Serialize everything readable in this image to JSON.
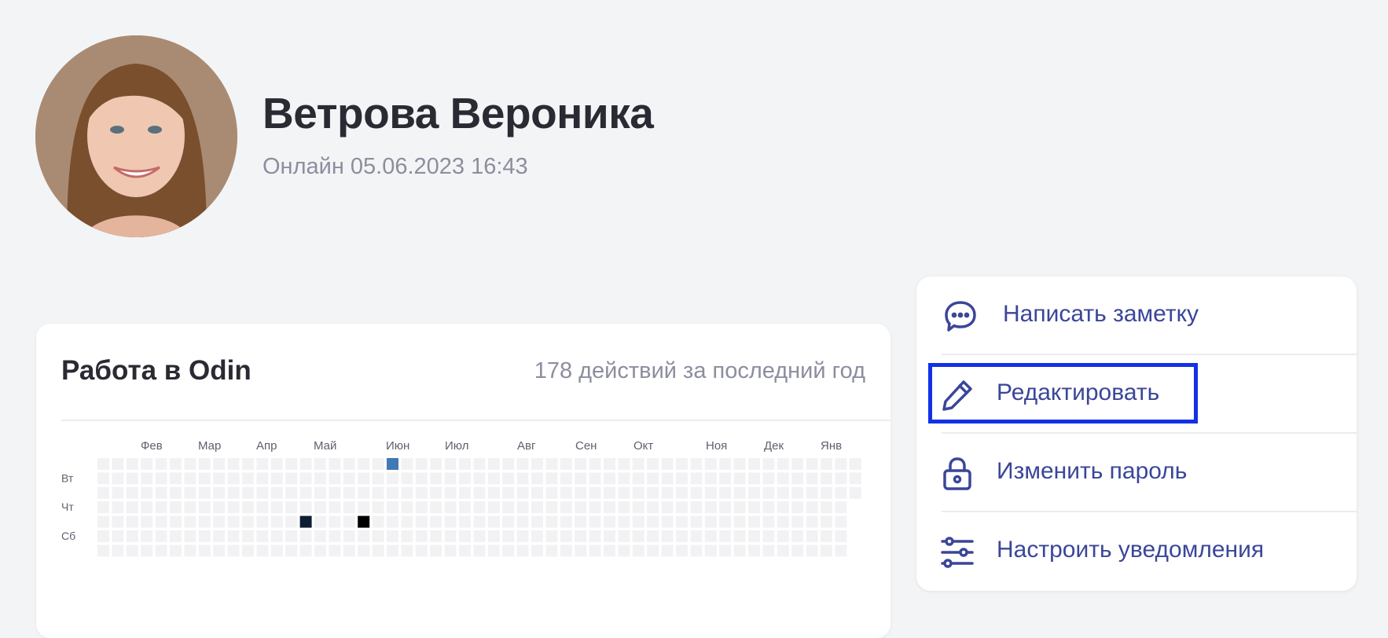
{
  "profile": {
    "name": "Ветрова Вероника",
    "status": "Онлайн 05.06.2023 16:43",
    "avatar_icon": "user-photo"
  },
  "activity": {
    "title": "Работа в Odin",
    "summary": "178 действий за последний год",
    "months": [
      "Фев",
      "Мар",
      "Апр",
      "Май",
      "Июн",
      "Июл",
      "Авг",
      "Сен",
      "Окт",
      "Ноя",
      "Дек",
      "Янв"
    ],
    "weekdays": [
      "Вт",
      "Чт",
      "Сб"
    ],
    "weeks": 53,
    "days_per_week": 7,
    "empty_color": "#f2f2f4",
    "highlighted_cells": [
      {
        "week": 20,
        "day": 0,
        "color": "#3f7ab5"
      },
      {
        "week": 14,
        "day": 4,
        "color": "#0e1f33"
      },
      {
        "week": 18,
        "day": 4,
        "color": "#000000"
      }
    ]
  },
  "actions": [
    {
      "label": "Написать заметку",
      "icon": "chat-bubble-icon"
    },
    {
      "label": "Редактировать",
      "icon": "pencil-icon"
    },
    {
      "label": "Изменить пароль",
      "icon": "lock-icon"
    },
    {
      "label": "Настроить уведомления",
      "icon": "sliders-icon"
    }
  ],
  "colors": {
    "accent": "#3a4699",
    "focus": "#1231e6",
    "text_primary": "#2a2a33",
    "text_muted": "#8c8e9e",
    "background": "#f3f4f6"
  }
}
